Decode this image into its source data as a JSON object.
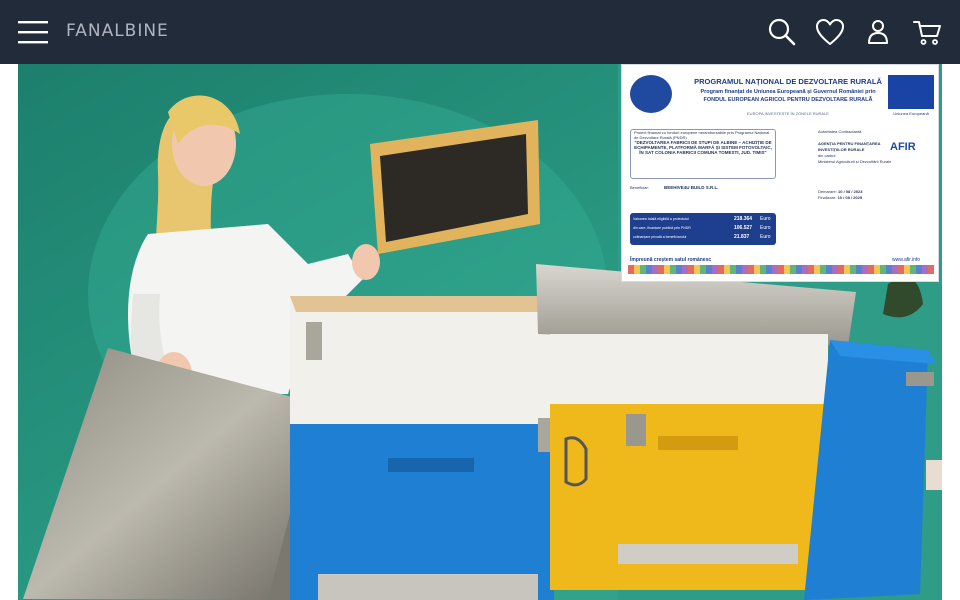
{
  "header": {
    "brand": "FANALBINE",
    "menu_icon": "hamburger-menu-icon",
    "actions": [
      {
        "name": "search",
        "icon": "search-icon"
      },
      {
        "name": "wishlist",
        "icon": "heart-icon"
      },
      {
        "name": "account",
        "icon": "user-icon"
      },
      {
        "name": "cart",
        "icon": "shopping-cart-icon"
      }
    ]
  },
  "hero": {
    "image": "hero-photo",
    "poster": {
      "title": "PROGRAMUL NAȚIONAL DE DEZVOLTARE RURALĂ",
      "line1": "Program finanțat de Uniunea Europeană și Guvernul României prin",
      "line2": "FONDUL EUROPEAN AGRICOL PENTRU DEZVOLTARE RURALĂ",
      "small": "EUROPA INVESTEȘTE ÎN ZONELE RURALE",
      "eu_caption": "Uniunea Europeană",
      "project_intro": "Proiect finanțat cu fonduri europene nerambursabile prin Programul Național de Dezvoltare Rurală (PNDR)",
      "project_title": "\"DEZVOLTAREA FABRICII DE STUPI DE ALBINE – ACHIZIȚIE DE ECHIPAMENTE, PLATFORMĂ MARFĂ ȘI SISTEM FOTOVOLTAIC, ÎN SAT COLONIA FABRICII COMUNA TOMESTI, JUD. TIMIS\"",
      "beneficiary_label": "Beneficiar:",
      "beneficiary": "BEEHIVE4U BUILD S.R.L.",
      "authority_label": "Autoritatea Contractantă",
      "authority": "AGENȚIA PENTRU FINANȚAREA INVESTIȚIILOR RURALE",
      "authority_sub": "din cadrul",
      "ministry": "Ministerul Agriculturii și Dezvoltării Rurale",
      "afir": "AFIR",
      "values": [
        {
          "label": "Valoarea totală eligibilă a proiectului",
          "amount": "218.364",
          "unit": "Euro"
        },
        {
          "label": "din care, finanțare publică prin PNDR",
          "amount": "106.527",
          "unit": "Euro"
        },
        {
          "label": "cofinanțare privată a beneficiarului",
          "amount": "21.837",
          "unit": "Euro"
        }
      ],
      "start_label": "Demarare:",
      "start_date": "10 / 08 / 2023",
      "end_label": "Finalizare:",
      "end_date": "10 / 08 / 2025",
      "slogan": "Împreună creștem satul românesc",
      "site": "www.afir.info"
    }
  },
  "colors": {
    "navbar": "#222b3a",
    "brand_text": "#aeb4c0",
    "icon": "#ffffff",
    "backdrop": "#1f8a74",
    "hive_blue": "#1f7fd3",
    "hive_yellow": "#efb81b",
    "hive_white": "#f2f0ea"
  }
}
